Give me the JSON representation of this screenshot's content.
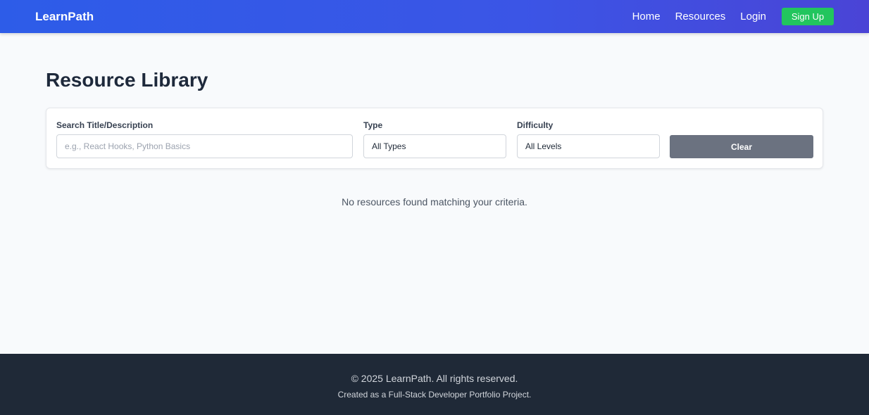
{
  "navbar": {
    "brand": "LearnPath",
    "links": [
      "Home",
      "Resources",
      "Login"
    ],
    "signup_label": "Sign Up"
  },
  "page": {
    "title": "Resource Library"
  },
  "filters": {
    "search": {
      "label": "Search Title/Description",
      "placeholder": "e.g., React Hooks, Python Basics",
      "value": ""
    },
    "type": {
      "label": "Type",
      "selected": "All Types"
    },
    "difficulty": {
      "label": "Difficulty",
      "selected": "All Levels"
    },
    "clear_label": "Clear"
  },
  "results": {
    "empty_message": "No resources found matching your criteria."
  },
  "footer": {
    "copyright": "© 2025 LearnPath. All rights reserved.",
    "tagline": "Created as a Full-Stack Developer Portfolio Project."
  },
  "colors": {
    "navbar_gradient_start": "#2d5ce8",
    "navbar_gradient_end": "#4a44d6",
    "signup_green": "#22c55e",
    "clear_gray": "#6b7280",
    "footer_bg": "#1f2937"
  }
}
